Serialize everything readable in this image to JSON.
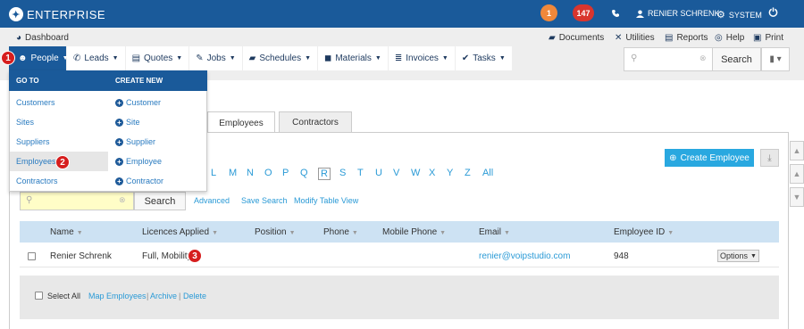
{
  "app": {
    "title": "ENTERPRISE",
    "logo_glyph": "✦"
  },
  "topbar": {
    "notifications_count": "1",
    "messages_count": "147",
    "user_name": "RENIER SCHRENK",
    "system_label": "SYSTEM"
  },
  "subbar": {
    "dashboard": "Dashboard",
    "documents": "Documents",
    "utilities": "Utilities",
    "reports": "Reports",
    "help": "Help",
    "print": "Print"
  },
  "nav": [
    {
      "label": "People",
      "active": true
    },
    {
      "label": "Leads"
    },
    {
      "label": "Quotes"
    },
    {
      "label": "Jobs"
    },
    {
      "label": "Schedules"
    },
    {
      "label": "Materials"
    },
    {
      "label": "Invoices"
    },
    {
      "label": "Tasks"
    }
  ],
  "top_search": {
    "button": "Search",
    "placeholder": ""
  },
  "dropdown": {
    "goto_header": "GO TO",
    "create_header": "CREATE NEW",
    "goto": [
      "Customers",
      "Sites",
      "Suppliers",
      "Employees",
      "Contractors"
    ],
    "create": [
      "Customer",
      "Site",
      "Supplier",
      "Employee",
      "Contractor"
    ]
  },
  "tabs": [
    "Employees",
    "Contractors"
  ],
  "create_button": "Create Employee",
  "alphabet": [
    "L",
    "M",
    "N",
    "O",
    "P",
    "Q",
    "R",
    "S",
    "T",
    "U",
    "V",
    "W",
    "X",
    "Y",
    "Z",
    "All"
  ],
  "alphabet_selected": "R",
  "emp_search": {
    "button": "Search",
    "advanced": "Advanced",
    "save": "Save Search",
    "modify": "Modify Table View"
  },
  "table": {
    "columns": [
      "Name",
      "Licences Applied",
      "Position",
      "Phone",
      "Mobile Phone",
      "Email",
      "Employee ID"
    ],
    "rows": [
      {
        "name": "Renier Schrenk",
        "licences": "Full, Mobility",
        "position": "",
        "phone": "",
        "mobile": "",
        "email": "renier@voipstudio.com",
        "id": "948",
        "options": "Options"
      }
    ]
  },
  "footer": {
    "select_all": "Select All",
    "map": "Map Employees",
    "archive": "Archive",
    "delete": "Delete",
    "sep": "|"
  },
  "steps": [
    "1",
    "2",
    "3"
  ],
  "colors": {
    "primary": "#1a5a9a",
    "accent": "#29a8e0",
    "step": "#d61e1e"
  }
}
